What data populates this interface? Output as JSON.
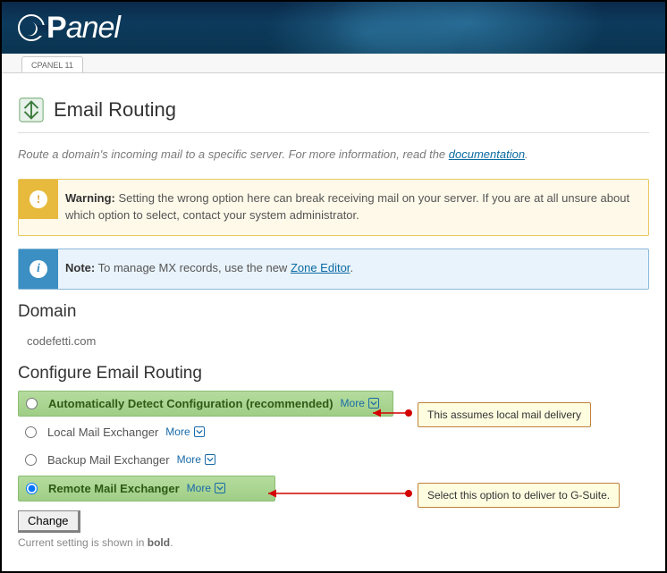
{
  "header": {
    "brand": "cPanel",
    "tab": "CPANEL 11"
  },
  "page": {
    "icon_name": "routing-icon",
    "title": "Email Routing",
    "intro_prefix": "Route a domain's incoming mail to a specific server. For more information, read the ",
    "intro_link": "documentation",
    "intro_suffix": "."
  },
  "alerts": {
    "warning": {
      "strong": "Warning:",
      "text": " Setting the wrong option here can break receiving mail on your server. If you are at all unsure about which option to select, contact your system administrator."
    },
    "note": {
      "strong": "Note:",
      "text_before": " To manage MX records, use the new ",
      "link": "Zone Editor",
      "text_after": "."
    }
  },
  "domain": {
    "heading": "Domain",
    "value": "codefetti.com"
  },
  "configure": {
    "heading": "Configure Email Routing",
    "more_label": "More",
    "options": [
      {
        "id": "auto",
        "label": "Automatically Detect Configuration (recommended)",
        "selected": true,
        "highlighted": true
      },
      {
        "id": "local",
        "label": "Local Mail Exchanger",
        "selected": false,
        "highlighted": false
      },
      {
        "id": "backup",
        "label": "Backup Mail Exchanger",
        "selected": false,
        "highlighted": false
      },
      {
        "id": "remote",
        "label": "Remote Mail Exchanger",
        "selected": true,
        "highlighted": true
      }
    ],
    "change_button": "Change",
    "current_note_prefix": "Current setting is shown in ",
    "current_note_bold": "bold",
    "current_note_suffix": "."
  },
  "annotations": {
    "auto": "This assumes local mail delivery",
    "remote": "Select this option to deliver to G-Suite."
  }
}
